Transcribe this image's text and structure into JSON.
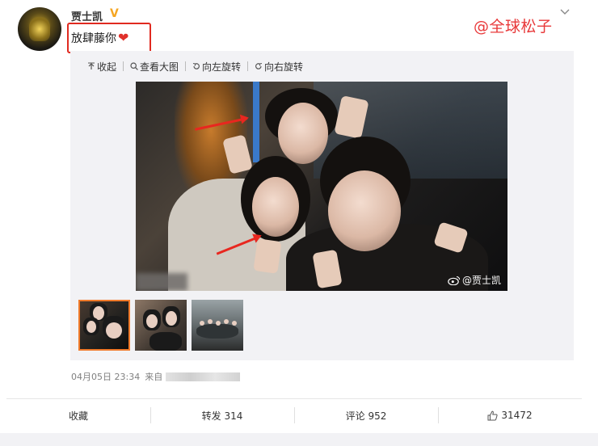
{
  "post": {
    "username": "贾士凯",
    "verified_badge": "V",
    "text": "放肆藤你",
    "watermark": "@全球松子"
  },
  "toolbar": {
    "collapse": "收起",
    "view_large": "查看大图",
    "rotate_left": "向左旋转",
    "rotate_right": "向右旋转"
  },
  "photo": {
    "watermark": "@贾士凯"
  },
  "meta": {
    "timestamp": "04月05日 23:34",
    "source_prefix": "来自"
  },
  "actions": {
    "favorite": "收藏",
    "repost": "转发 314",
    "comment": "评论 952",
    "likes": "31472"
  },
  "colors": {
    "highlight_red": "#e02a20",
    "watermark_red": "#e8393a",
    "verified_orange": "#f5a623",
    "thumb_selected": "#f07a2a"
  }
}
